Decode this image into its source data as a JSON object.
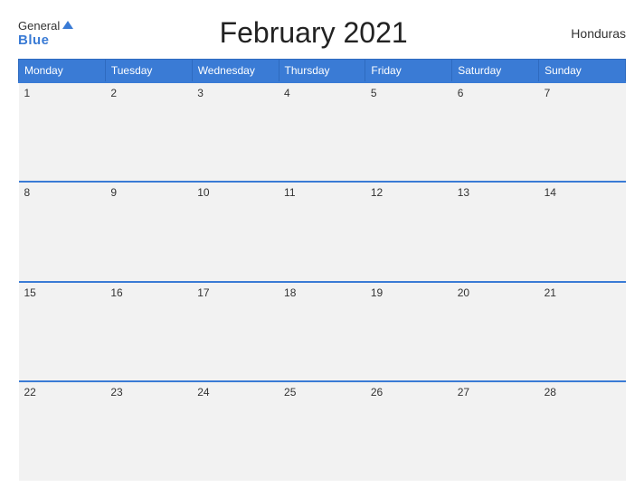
{
  "header": {
    "logo": {
      "general": "General",
      "blue": "Blue"
    },
    "title": "February 2021",
    "country": "Honduras"
  },
  "calendar": {
    "days_of_week": [
      "Monday",
      "Tuesday",
      "Wednesday",
      "Thursday",
      "Friday",
      "Saturday",
      "Sunday"
    ],
    "weeks": [
      [
        {
          "date": "1",
          "events": []
        },
        {
          "date": "2",
          "events": []
        },
        {
          "date": "3",
          "events": []
        },
        {
          "date": "4",
          "events": []
        },
        {
          "date": "5",
          "events": []
        },
        {
          "date": "6",
          "events": []
        },
        {
          "date": "7",
          "events": []
        }
      ],
      [
        {
          "date": "8",
          "events": []
        },
        {
          "date": "9",
          "events": []
        },
        {
          "date": "10",
          "events": []
        },
        {
          "date": "11",
          "events": []
        },
        {
          "date": "12",
          "events": []
        },
        {
          "date": "13",
          "events": []
        },
        {
          "date": "14",
          "events": []
        }
      ],
      [
        {
          "date": "15",
          "events": []
        },
        {
          "date": "16",
          "events": []
        },
        {
          "date": "17",
          "events": []
        },
        {
          "date": "18",
          "events": []
        },
        {
          "date": "19",
          "events": []
        },
        {
          "date": "20",
          "events": []
        },
        {
          "date": "21",
          "events": []
        }
      ],
      [
        {
          "date": "22",
          "events": []
        },
        {
          "date": "23",
          "events": []
        },
        {
          "date": "24",
          "events": []
        },
        {
          "date": "25",
          "events": []
        },
        {
          "date": "26",
          "events": []
        },
        {
          "date": "27",
          "events": []
        },
        {
          "date": "28",
          "events": []
        }
      ]
    ]
  }
}
